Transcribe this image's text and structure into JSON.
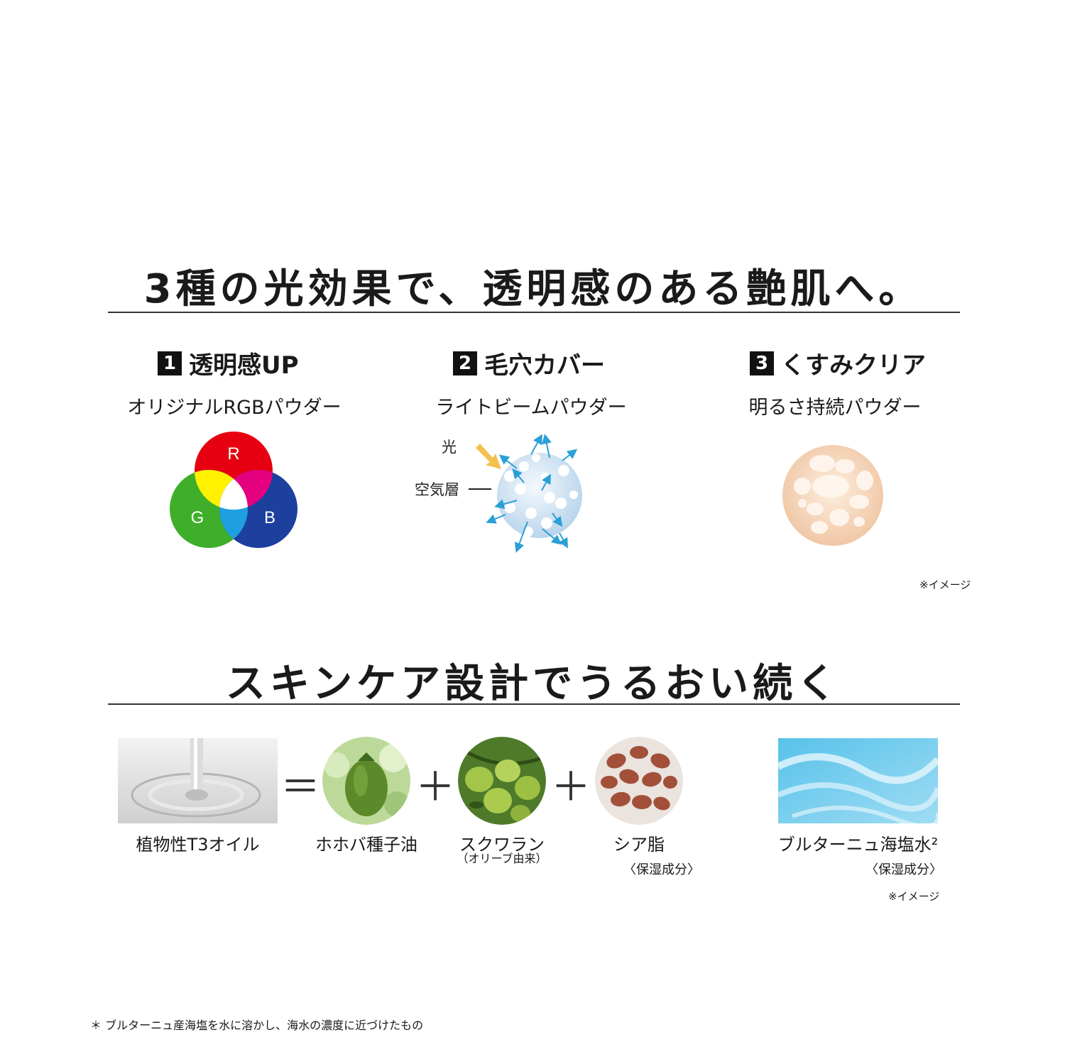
{
  "section1": {
    "heading": "3種の光効果で、透明感のある艶肌へ。",
    "features": [
      {
        "number": "1",
        "title": "透明感UP",
        "subtitle": "オリジナルRGBパウダー"
      },
      {
        "number": "2",
        "title": "毛穴カバー",
        "subtitle": "ライトビームパウダー"
      },
      {
        "number": "3",
        "title": "くすみクリア",
        "subtitle": "明るさ持続パウダー"
      }
    ],
    "rgb_labels": {
      "r": "R",
      "g": "G",
      "b": "B"
    },
    "beam_labels": {
      "light": "光",
      "air": "空気層"
    },
    "image_note": "※イメージ"
  },
  "section2": {
    "heading": "スキンケア設計でうるおい続く",
    "operators": {
      "equals": "＝",
      "plus1": "＋",
      "plus2": "＋"
    },
    "ingredients": [
      {
        "label": "植物性T3オイル"
      },
      {
        "label": "ホホバ種子油"
      },
      {
        "label": "スクワラン",
        "sub": "（オリーブ由来）"
      },
      {
        "label": "シア脂",
        "sub": "〈保湿成分〉"
      },
      {
        "label": "ブルターニュ海塩水²",
        "sub": "〈保湿成分〉"
      }
    ],
    "image_note": "※イメージ"
  },
  "footnote": "＊ ブルターニュ産海塩を水に溶かし、海水の濃度に近づけたもの",
  "colors": {
    "red": "#e60012",
    "green": "#3fae2a",
    "blue": "#1d3f9e",
    "yellow": "#fff100",
    "accent_arrow": "#2aa0d6",
    "light_arrow": "#f2c14e"
  }
}
